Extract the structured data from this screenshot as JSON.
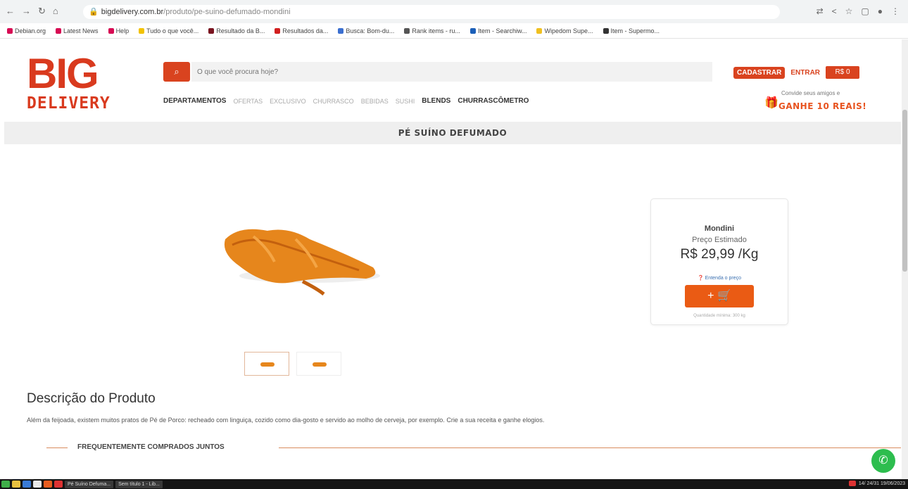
{
  "browser": {
    "url_domain": "bigdelivery.com.br",
    "url_path": "/produto/pe-suino-defumado-mondini"
  },
  "bookmarks": [
    {
      "label": "Debian.org",
      "color": "#d70a53"
    },
    {
      "label": "Latest News",
      "color": "#d70a53"
    },
    {
      "label": "Help",
      "color": "#d70a53"
    },
    {
      "label": "Tudo o que você...",
      "color": "#f2c200"
    },
    {
      "label": "Resultado da B...",
      "color": "#7a1420"
    },
    {
      "label": "Resultados da...",
      "color": "#d21f1f"
    },
    {
      "label": "Busca: Bom-du...",
      "color": "#3b6fd0"
    },
    {
      "label": "Rank items - ru...",
      "color": "#555555"
    },
    {
      "label": "Item - Searchiw...",
      "color": "#1b5fb8"
    },
    {
      "label": "Wipedom Supe...",
      "color": "#f0c020"
    },
    {
      "label": "Item - Supermo...",
      "color": "#333333"
    }
  ],
  "logo": {
    "line1": "BIG",
    "line2": "DELIVERY"
  },
  "search": {
    "placeholder": "O que você procura hoje?"
  },
  "header": {
    "register": "CADASTRAR",
    "login": "ENTRAR",
    "cart": "R$ 0"
  },
  "nav": [
    {
      "label": "DEPARTAMENTOS",
      "style": "strong"
    },
    {
      "label": "OFERTAS",
      "style": "light"
    },
    {
      "label": "EXCLUSIVO",
      "style": "light"
    },
    {
      "label": "CHURRASCO",
      "style": "light"
    },
    {
      "label": "BEBIDAS",
      "style": "light"
    },
    {
      "label": "SUSHI",
      "style": "light"
    },
    {
      "label": "BLENDS",
      "style": "strong"
    },
    {
      "label": "CHURRASCÔMETRO",
      "style": "strong"
    }
  ],
  "invite": {
    "small": "Convide seus amigos e",
    "big": "GANHE 10 REAIS!"
  },
  "page_title": "PÉ SUÍNO DEFUMADO",
  "price_card": {
    "brand": "Mondini",
    "estimated_label": "Preço Estimado",
    "price": "R$ 29,99 /Kg",
    "how_link": "Entenda o preço",
    "min_qty": "Quantidade mínima: 300 kg"
  },
  "description": {
    "title": "Descrição do Produto",
    "text": "Além da feijoada, existem muitos pratos de Pé de Porco: recheado com linguiça, cozido como dia-gosto e servido ao molho de cerveja, por exemplo. Crie a sua receita e ganhe elogios."
  },
  "frequently_bought": "FREQUENTEMENTE COMPRADOS JUNTOS",
  "taskbar": {
    "task1": "Pé Suíno Defuma...",
    "task2": "Sem título 1 - Lib...",
    "clock": "14/ 24/31 19/06/2023"
  },
  "colors": {
    "brand": "#d93a1e",
    "accent": "#ea5b14",
    "whatsapp": "#2dbd4e"
  }
}
